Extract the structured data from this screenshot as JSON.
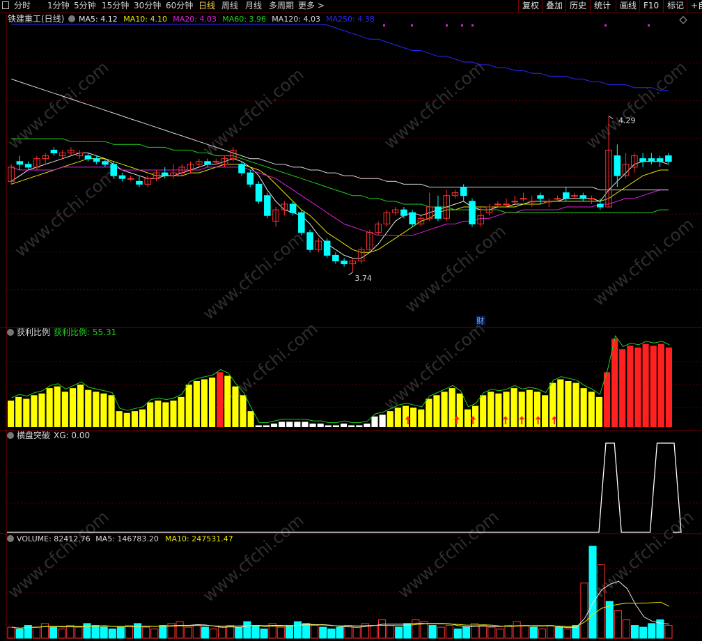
{
  "toolbar": {
    "periods": [
      "分时",
      "1分钟",
      "5分钟",
      "15分钟",
      "30分钟",
      "60分钟",
      "日线",
      "周线",
      "月线",
      "多周期",
      "更多 >"
    ],
    "active_period": "日线",
    "right_buttons": [
      "复权",
      "叠加",
      "历史",
      "统计",
      "画线",
      "F10",
      "标记",
      "+自"
    ]
  },
  "main_panel": {
    "title": "铁建重工(日线)",
    "ma": [
      {
        "label": "MA5: 4.12",
        "color": "#e6e6e6"
      },
      {
        "label": "MA10: 4.10",
        "color": "#e6e600"
      },
      {
        "label": "MA20: 4.03",
        "color": "#e020e0"
      },
      {
        "label": "MA60: 3.96",
        "color": "#20d020"
      },
      {
        "label": "MA120: 4.03",
        "color": "#d8d8d8"
      },
      {
        "label": "MA250: 4.38",
        "color": "#2828ff"
      }
    ],
    "high_label": "4.29",
    "low_label": "3.74",
    "cai_marker": "财"
  },
  "profit_panel": {
    "title": "获利比例",
    "value_label": "获利比例: 55.31"
  },
  "xg_panel": {
    "title": "横盘突破",
    "value_label": "XG: 0.00"
  },
  "volume_panel": {
    "labels": [
      {
        "text": "VOLUME: 82412.76",
        "color": "#d8d8d8"
      },
      {
        "text": "MA5: 146783.20",
        "color": "#d8d8d8"
      },
      {
        "text": "MA10: 247531.47",
        "color": "#e6e600"
      }
    ]
  },
  "watermark": "www.cfchi.com",
  "colors": {
    "up": "#ff3232",
    "down": "#00ffff",
    "grid": "#5a0000",
    "ma5": "#e6e6e6",
    "ma10": "#e6e600",
    "ma20": "#e020e0",
    "ma60": "#20d020",
    "ma120": "#d8d8d8",
    "ma250": "#2828ff"
  },
  "chart_data": [
    {
      "type": "candlestick",
      "title": "铁建重工(日线)",
      "y_range": [
        3.6,
        4.6
      ],
      "candles": [
        [
          4.06,
          4.11,
          4.12,
          4.05
        ],
        [
          4.13,
          4.12,
          4.15,
          4.1
        ],
        [
          4.12,
          4.11,
          4.13,
          4.1
        ],
        [
          4.11,
          4.14,
          4.15,
          4.1
        ],
        [
          4.14,
          4.15,
          4.16,
          4.12
        ],
        [
          4.17,
          4.16,
          4.18,
          4.15
        ],
        [
          4.15,
          4.16,
          4.17,
          4.14
        ],
        [
          4.16,
          4.17,
          4.18,
          4.15
        ],
        [
          4.15,
          4.16,
          4.17,
          4.14
        ],
        [
          4.15,
          4.14,
          4.16,
          4.13
        ],
        [
          4.14,
          4.13,
          4.15,
          4.12
        ],
        [
          4.13,
          4.12,
          4.14,
          4.11
        ],
        [
          4.12,
          4.08,
          4.13,
          4.07
        ],
        [
          4.08,
          4.07,
          4.09,
          4.06
        ],
        [
          4.07,
          4.07,
          4.08,
          4.06
        ],
        [
          4.06,
          4.05,
          4.08,
          4.04
        ],
        [
          4.05,
          4.07,
          4.08,
          4.04
        ],
        [
          4.07,
          4.09,
          4.1,
          4.06
        ],
        [
          4.09,
          4.08,
          4.11,
          4.07
        ],
        [
          4.08,
          4.09,
          4.12,
          4.07
        ],
        [
          4.09,
          4.11,
          4.12,
          4.08
        ],
        [
          4.1,
          4.12,
          4.13,
          4.09
        ],
        [
          4.12,
          4.13,
          4.14,
          4.11
        ],
        [
          4.13,
          4.12,
          4.14,
          4.11
        ],
        [
          4.13,
          4.13,
          4.14,
          4.12
        ],
        [
          4.12,
          4.14,
          4.15,
          4.11
        ],
        [
          4.14,
          4.17,
          4.18,
          4.13
        ],
        [
          4.12,
          4.09,
          4.13,
          4.08
        ],
        [
          4.09,
          4.05,
          4.1,
          4.04
        ],
        [
          4.05,
          3.99,
          4.06,
          3.98
        ],
        [
          4.01,
          3.94,
          4.02,
          3.93
        ],
        [
          3.92,
          3.96,
          3.97,
          3.9
        ],
        [
          3.96,
          3.98,
          3.99,
          3.94
        ],
        [
          3.98,
          3.95,
          3.99,
          3.94
        ],
        [
          3.95,
          3.88,
          3.96,
          3.87
        ],
        [
          3.88,
          3.82,
          3.89,
          3.81
        ],
        [
          3.82,
          3.85,
          3.86,
          3.81
        ],
        [
          3.85,
          3.8,
          3.86,
          3.79
        ],
        [
          3.8,
          3.78,
          3.81,
          3.77
        ],
        [
          3.78,
          3.77,
          3.79,
          3.76
        ],
        [
          3.77,
          3.78,
          3.79,
          3.74
        ],
        [
          3.78,
          3.82,
          3.83,
          3.77
        ],
        [
          3.82,
          3.88,
          3.89,
          3.81
        ],
        [
          3.88,
          3.91,
          3.92,
          3.87
        ],
        [
          3.91,
          3.95,
          3.96,
          3.9
        ],
        [
          3.95,
          3.96,
          3.97,
          3.94
        ],
        [
          3.96,
          3.94,
          3.97,
          3.93
        ],
        [
          3.95,
          3.91,
          3.96,
          3.9
        ],
        [
          3.91,
          3.93,
          3.94,
          3.9
        ],
        [
          3.93,
          3.97,
          4.02,
          3.92
        ],
        [
          3.97,
          3.93,
          4.01,
          3.92
        ],
        [
          3.93,
          4.01,
          4.03,
          3.92
        ],
        [
          4.01,
          4.02,
          4.03,
          4.0
        ],
        [
          4.04,
          4.01,
          4.05,
          3.99
        ],
        [
          3.99,
          3.91,
          4.0,
          3.9
        ],
        [
          3.91,
          3.94,
          3.97,
          3.9
        ],
        [
          3.95,
          3.97,
          3.98,
          3.94
        ],
        [
          3.98,
          3.98,
          3.99,
          3.97
        ],
        [
          3.98,
          3.98,
          4.0,
          3.97
        ],
        [
          3.99,
          3.99,
          4.01,
          3.98
        ],
        [
          4.0,
          4.0,
          4.02,
          3.99
        ],
        [
          3.99,
          3.99,
          4.01,
          3.97
        ],
        [
          4.01,
          4.0,
          4.02,
          3.98
        ],
        [
          3.99,
          3.99,
          4.0,
          3.97
        ],
        [
          4.0,
          4.0,
          4.01,
          3.99
        ],
        [
          4.02,
          4.0,
          4.04,
          3.99
        ],
        [
          4.01,
          4.01,
          4.02,
          4.0
        ],
        [
          4.01,
          4.0,
          4.02,
          3.99
        ],
        [
          4.0,
          4.0,
          4.01,
          3.98
        ],
        [
          3.98,
          3.97,
          4.0,
          3.96
        ],
        [
          3.97,
          4.17,
          4.29,
          3.97
        ],
        [
          4.15,
          4.08,
          4.19,
          4.04
        ],
        [
          4.08,
          4.12,
          4.16,
          4.07
        ],
        [
          4.11,
          4.15,
          4.16,
          4.09
        ],
        [
          4.14,
          4.13,
          4.16,
          4.11
        ],
        [
          4.14,
          4.13,
          4.16,
          4.12
        ],
        [
          4.14,
          4.13,
          4.15,
          4.11
        ],
        [
          4.15,
          4.13,
          4.16,
          4.12
        ]
      ],
      "ma": {
        "MA5": [
          4.06,
          4.08,
          4.1,
          4.11,
          4.12,
          4.13,
          4.14,
          4.15,
          4.16,
          4.16,
          4.15,
          4.14,
          4.12,
          4.1,
          4.09,
          4.08,
          4.07,
          4.07,
          4.08,
          4.08,
          4.09,
          4.1,
          4.11,
          4.12,
          4.12,
          4.13,
          4.14,
          4.13,
          4.11,
          4.08,
          4.03,
          3.99,
          3.96,
          3.95,
          3.94,
          3.91,
          3.87,
          3.84,
          3.82,
          3.8,
          3.79,
          3.79,
          3.81,
          3.84,
          3.88,
          3.92,
          3.94,
          3.95,
          3.94,
          3.95,
          3.96,
          3.97,
          3.98,
          3.99,
          3.97,
          3.96,
          3.96,
          3.97,
          3.97,
          3.98,
          3.98,
          3.99,
          3.99,
          3.99,
          3.99,
          4.0,
          4.0,
          4.0,
          4.0,
          3.99,
          4.03,
          4.06,
          4.09,
          4.12,
          4.13,
          4.13,
          4.13,
          4.12
        ],
        "MA10": [
          4.05,
          4.06,
          4.07,
          4.08,
          4.09,
          4.1,
          4.11,
          4.12,
          4.13,
          4.14,
          4.14,
          4.14,
          4.13,
          4.12,
          4.11,
          4.1,
          4.09,
          4.08,
          4.08,
          4.08,
          4.08,
          4.09,
          4.09,
          4.1,
          4.11,
          4.12,
          4.12,
          4.12,
          4.11,
          4.1,
          4.08,
          4.05,
          4.02,
          3.99,
          3.96,
          3.94,
          3.91,
          3.88,
          3.86,
          3.84,
          3.82,
          3.81,
          3.81,
          3.82,
          3.84,
          3.86,
          3.88,
          3.9,
          3.92,
          3.93,
          3.95,
          3.96,
          3.96,
          3.97,
          3.97,
          3.97,
          3.97,
          3.97,
          3.97,
          3.97,
          3.98,
          3.98,
          3.98,
          3.99,
          3.99,
          3.99,
          3.99,
          3.99,
          3.99,
          3.99,
          4.0,
          4.02,
          4.04,
          4.06,
          4.08,
          4.09,
          4.1,
          4.1
        ],
        "MA20": [
          4.11,
          4.1,
          4.1,
          4.1,
          4.1,
          4.1,
          4.11,
          4.11,
          4.11,
          4.11,
          4.11,
          4.11,
          4.11,
          4.1,
          4.1,
          4.1,
          4.1,
          4.1,
          4.1,
          4.1,
          4.1,
          4.1,
          4.1,
          4.11,
          4.11,
          4.11,
          4.11,
          4.11,
          4.1,
          4.09,
          4.08,
          4.07,
          4.05,
          4.03,
          4.01,
          3.99,
          3.97,
          3.95,
          3.93,
          3.91,
          3.9,
          3.89,
          3.88,
          3.87,
          3.87,
          3.87,
          3.87,
          3.87,
          3.88,
          3.89,
          3.9,
          3.91,
          3.91,
          3.92,
          3.92,
          3.93,
          3.93,
          3.94,
          3.95,
          3.95,
          3.96,
          3.96,
          3.96,
          3.96,
          3.96,
          3.97,
          3.97,
          3.97,
          3.97,
          3.98,
          3.98,
          3.99,
          4.0,
          4.0,
          4.01,
          4.02,
          4.03,
          4.03
        ],
        "MA60": [
          4.21,
          4.21,
          4.21,
          4.21,
          4.21,
          4.21,
          4.21,
          4.2,
          4.2,
          4.2,
          4.2,
          4.2,
          4.19,
          4.19,
          4.19,
          4.19,
          4.18,
          4.18,
          4.18,
          4.17,
          4.17,
          4.17,
          4.16,
          4.16,
          4.15,
          4.15,
          4.15,
          4.14,
          4.13,
          4.12,
          4.11,
          4.1,
          4.09,
          4.08,
          4.07,
          4.06,
          4.05,
          4.04,
          4.03,
          4.02,
          4.01,
          4.01,
          4.0,
          4.0,
          3.99,
          3.99,
          3.98,
          3.98,
          3.98,
          3.97,
          3.97,
          3.97,
          3.96,
          3.96,
          3.96,
          3.96,
          3.96,
          3.96,
          3.95,
          3.95,
          3.95,
          3.95,
          3.95,
          3.95,
          3.95,
          3.95,
          3.95,
          3.95,
          3.95,
          3.95,
          3.95,
          3.95,
          3.95,
          3.95,
          3.95,
          3.95,
          3.96,
          3.96
        ],
        "MA120": [
          4.42,
          4.41,
          4.4,
          4.39,
          4.38,
          4.37,
          4.36,
          4.35,
          4.34,
          4.33,
          4.32,
          4.31,
          4.3,
          4.29,
          4.28,
          4.27,
          4.26,
          4.25,
          4.24,
          4.23,
          4.22,
          4.21,
          4.2,
          4.19,
          4.18,
          4.17,
          4.16,
          4.15,
          4.14,
          4.14,
          4.13,
          4.12,
          4.12,
          4.11,
          4.11,
          4.1,
          4.1,
          4.09,
          4.09,
          4.08,
          4.08,
          4.07,
          4.07,
          4.07,
          4.06,
          4.06,
          4.05,
          4.05,
          4.05,
          4.04,
          4.04,
          4.04,
          4.04,
          4.04,
          4.04,
          4.04,
          4.04,
          4.04,
          4.04,
          4.04,
          4.04,
          4.04,
          4.04,
          4.04,
          4.04,
          4.04,
          4.04,
          4.04,
          4.04,
          4.03,
          4.03,
          4.03,
          4.03,
          4.03,
          4.03,
          4.03,
          4.03,
          4.03
        ],
        "MA250": [
          4.98,
          4.97,
          4.96,
          4.95,
          4.94,
          4.93,
          4.92,
          4.91,
          4.9,
          4.89,
          4.88,
          4.87,
          4.86,
          4.85,
          4.84,
          4.83,
          4.82,
          4.81,
          4.8,
          4.79,
          4.78,
          4.77,
          4.76,
          4.75,
          4.74,
          4.73,
          4.72,
          4.71,
          4.7,
          4.69,
          4.68,
          4.67,
          4.66,
          4.65,
          4.64,
          4.63,
          4.62,
          4.61,
          4.6,
          4.59,
          4.58,
          4.57,
          4.56,
          4.56,
          4.55,
          4.54,
          4.53,
          4.52,
          4.52,
          4.51,
          4.5,
          4.5,
          4.49,
          4.48,
          4.48,
          4.47,
          4.47,
          4.46,
          4.46,
          4.45,
          4.45,
          4.44,
          4.44,
          4.43,
          4.43,
          4.43,
          4.42,
          4.42,
          4.41,
          4.41,
          4.4,
          4.4,
          4.4,
          4.39,
          4.39,
          4.39,
          4.38,
          4.38
        ]
      }
    },
    {
      "type": "bar",
      "title": "获利比例",
      "y_range": [
        0,
        100
      ],
      "values": [
        30,
        34,
        32,
        36,
        38,
        44,
        46,
        40,
        44,
        48,
        42,
        40,
        38,
        36,
        18,
        16,
        18,
        20,
        28,
        30,
        28,
        30,
        34,
        48,
        52,
        54,
        56,
        62,
        58,
        46,
        36,
        18,
        2,
        2,
        4,
        6,
        6,
        6,
        6,
        4,
        4,
        2,
        2,
        4,
        2,
        2,
        4,
        12,
        14,
        18,
        22,
        24,
        22,
        20,
        32,
        36,
        40,
        44,
        38,
        20,
        24,
        36,
        40,
        38,
        40,
        44,
        40,
        42,
        40,
        36,
        50,
        54,
        52,
        50,
        44,
        40,
        34,
        62,
        100,
        88,
        92,
        90,
        94,
        92,
        94,
        90
      ],
      "highlight": "white=low, yellow=mid, red=high",
      "arrows_at": [
        23,
        26,
        27,
        29,
        30,
        31,
        32
      ]
    },
    {
      "type": "line",
      "title": "横盘突破",
      "y_range": [
        0,
        1
      ],
      "spikes": [
        [
          70,
          71
        ],
        [
          76,
          78
        ]
      ]
    },
    {
      "type": "bar",
      "title": "VOLUME",
      "values": [
        12,
        10,
        14,
        12,
        16,
        12,
        10,
        14,
        12,
        16,
        14,
        12,
        10,
        12,
        14,
        16,
        12,
        10,
        14,
        16,
        18,
        12,
        14,
        12,
        10,
        12,
        14,
        12,
        18,
        14,
        10,
        16,
        12,
        14,
        18,
        16,
        14,
        12,
        10,
        12,
        14,
        12,
        16,
        14,
        20,
        14,
        12,
        16,
        20,
        18,
        14,
        12,
        14,
        10,
        12,
        16,
        14,
        12,
        10,
        14,
        18,
        14,
        12,
        10,
        14,
        12,
        10,
        14,
        60,
        100,
        80,
        40,
        30,
        20,
        14,
        12,
        16,
        20,
        14
      ]
    }
  ]
}
